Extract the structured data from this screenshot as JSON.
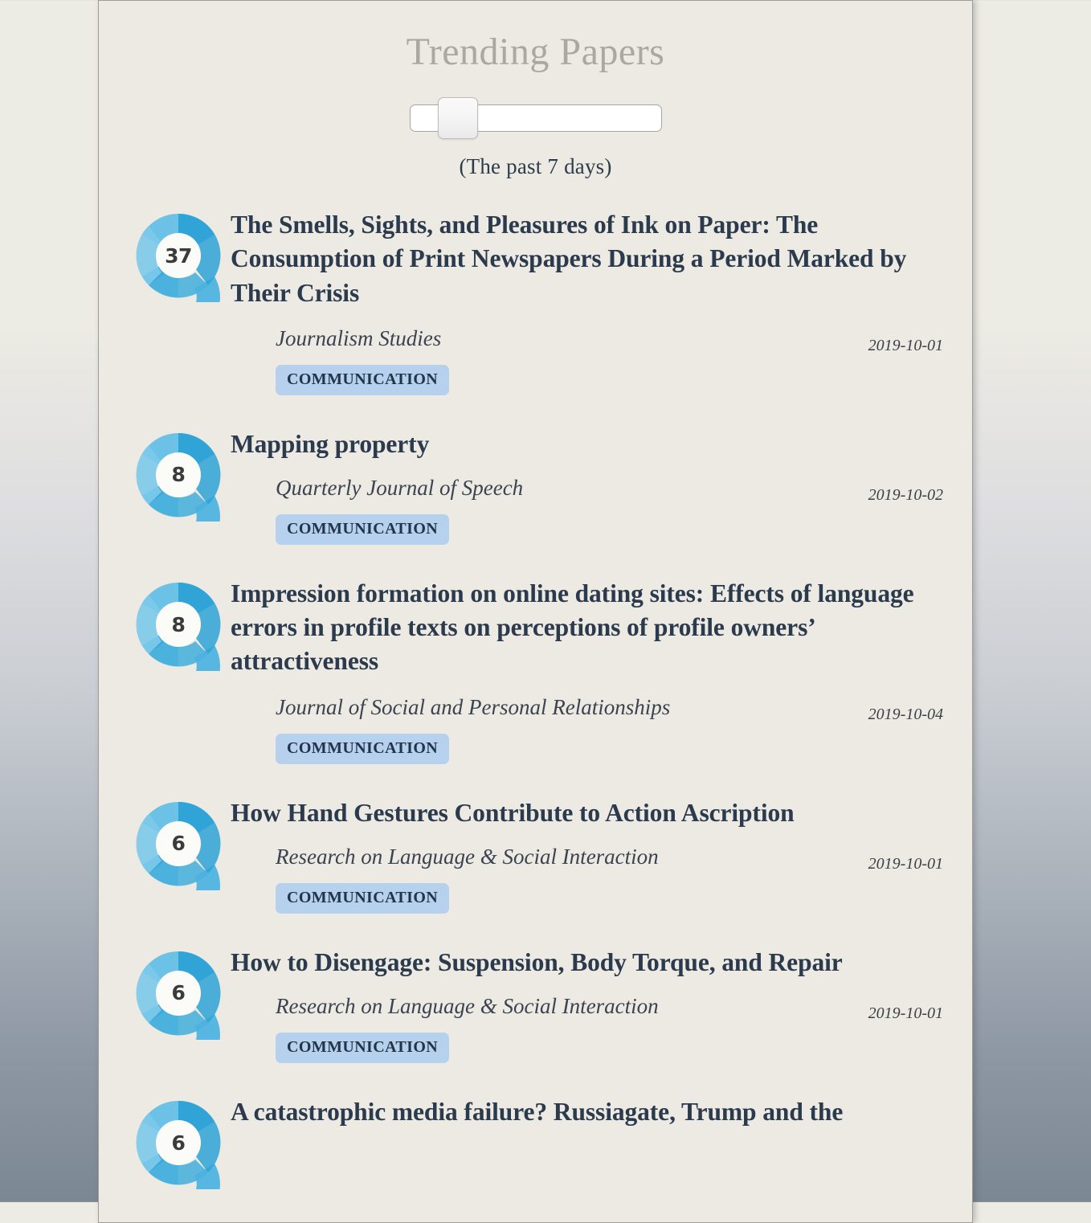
{
  "page": {
    "title": "Trending Papers",
    "range_caption": "(The past 7 days)"
  },
  "slider": {
    "name": "time-range-slider",
    "value": "7",
    "min": "1",
    "max": "30"
  },
  "colors": {
    "card_background": "#eceae2",
    "title_gray": "#aaa89f",
    "link_navy": "#2b3a4d",
    "link_underline": "#b9d1ea",
    "badge_blue": "#b5d1ed",
    "donut_blue": "#3fa9d8"
  },
  "papers": [
    {
      "score": "37",
      "title": "The Smells, Sights, and Pleasures of Ink on Paper: The Consumption of Print Newspapers During a Period Marked by Their Crisis",
      "journal": "Journalism Studies",
      "date": "2019-10-01",
      "category": "COMMUNICATION"
    },
    {
      "score": "8",
      "title": "Mapping property",
      "journal": "Quarterly Journal of Speech",
      "date": "2019-10-02",
      "category": "COMMUNICATION"
    },
    {
      "score": "8",
      "title": "Impression formation on online dating sites: Effects of language errors in profile texts on perceptions of profile owners’ attractiveness",
      "journal": "Journal of Social and Personal Relationships",
      "date": "2019-10-04",
      "category": "COMMUNICATION"
    },
    {
      "score": "6",
      "title": "How Hand Gestures Contribute to Action Ascription",
      "journal": "Research on Language & Social Interaction",
      "date": "2019-10-01",
      "category": "COMMUNICATION"
    },
    {
      "score": "6",
      "title": "How to Disengage: Suspension, Body Torque, and Repair",
      "journal": "Research on Language & Social Interaction",
      "date": "2019-10-01",
      "category": "COMMUNICATION"
    },
    {
      "score": "6",
      "title": "A catastrophic media failure? Russiagate, Trump and the",
      "journal": "",
      "date": "",
      "category": ""
    }
  ]
}
